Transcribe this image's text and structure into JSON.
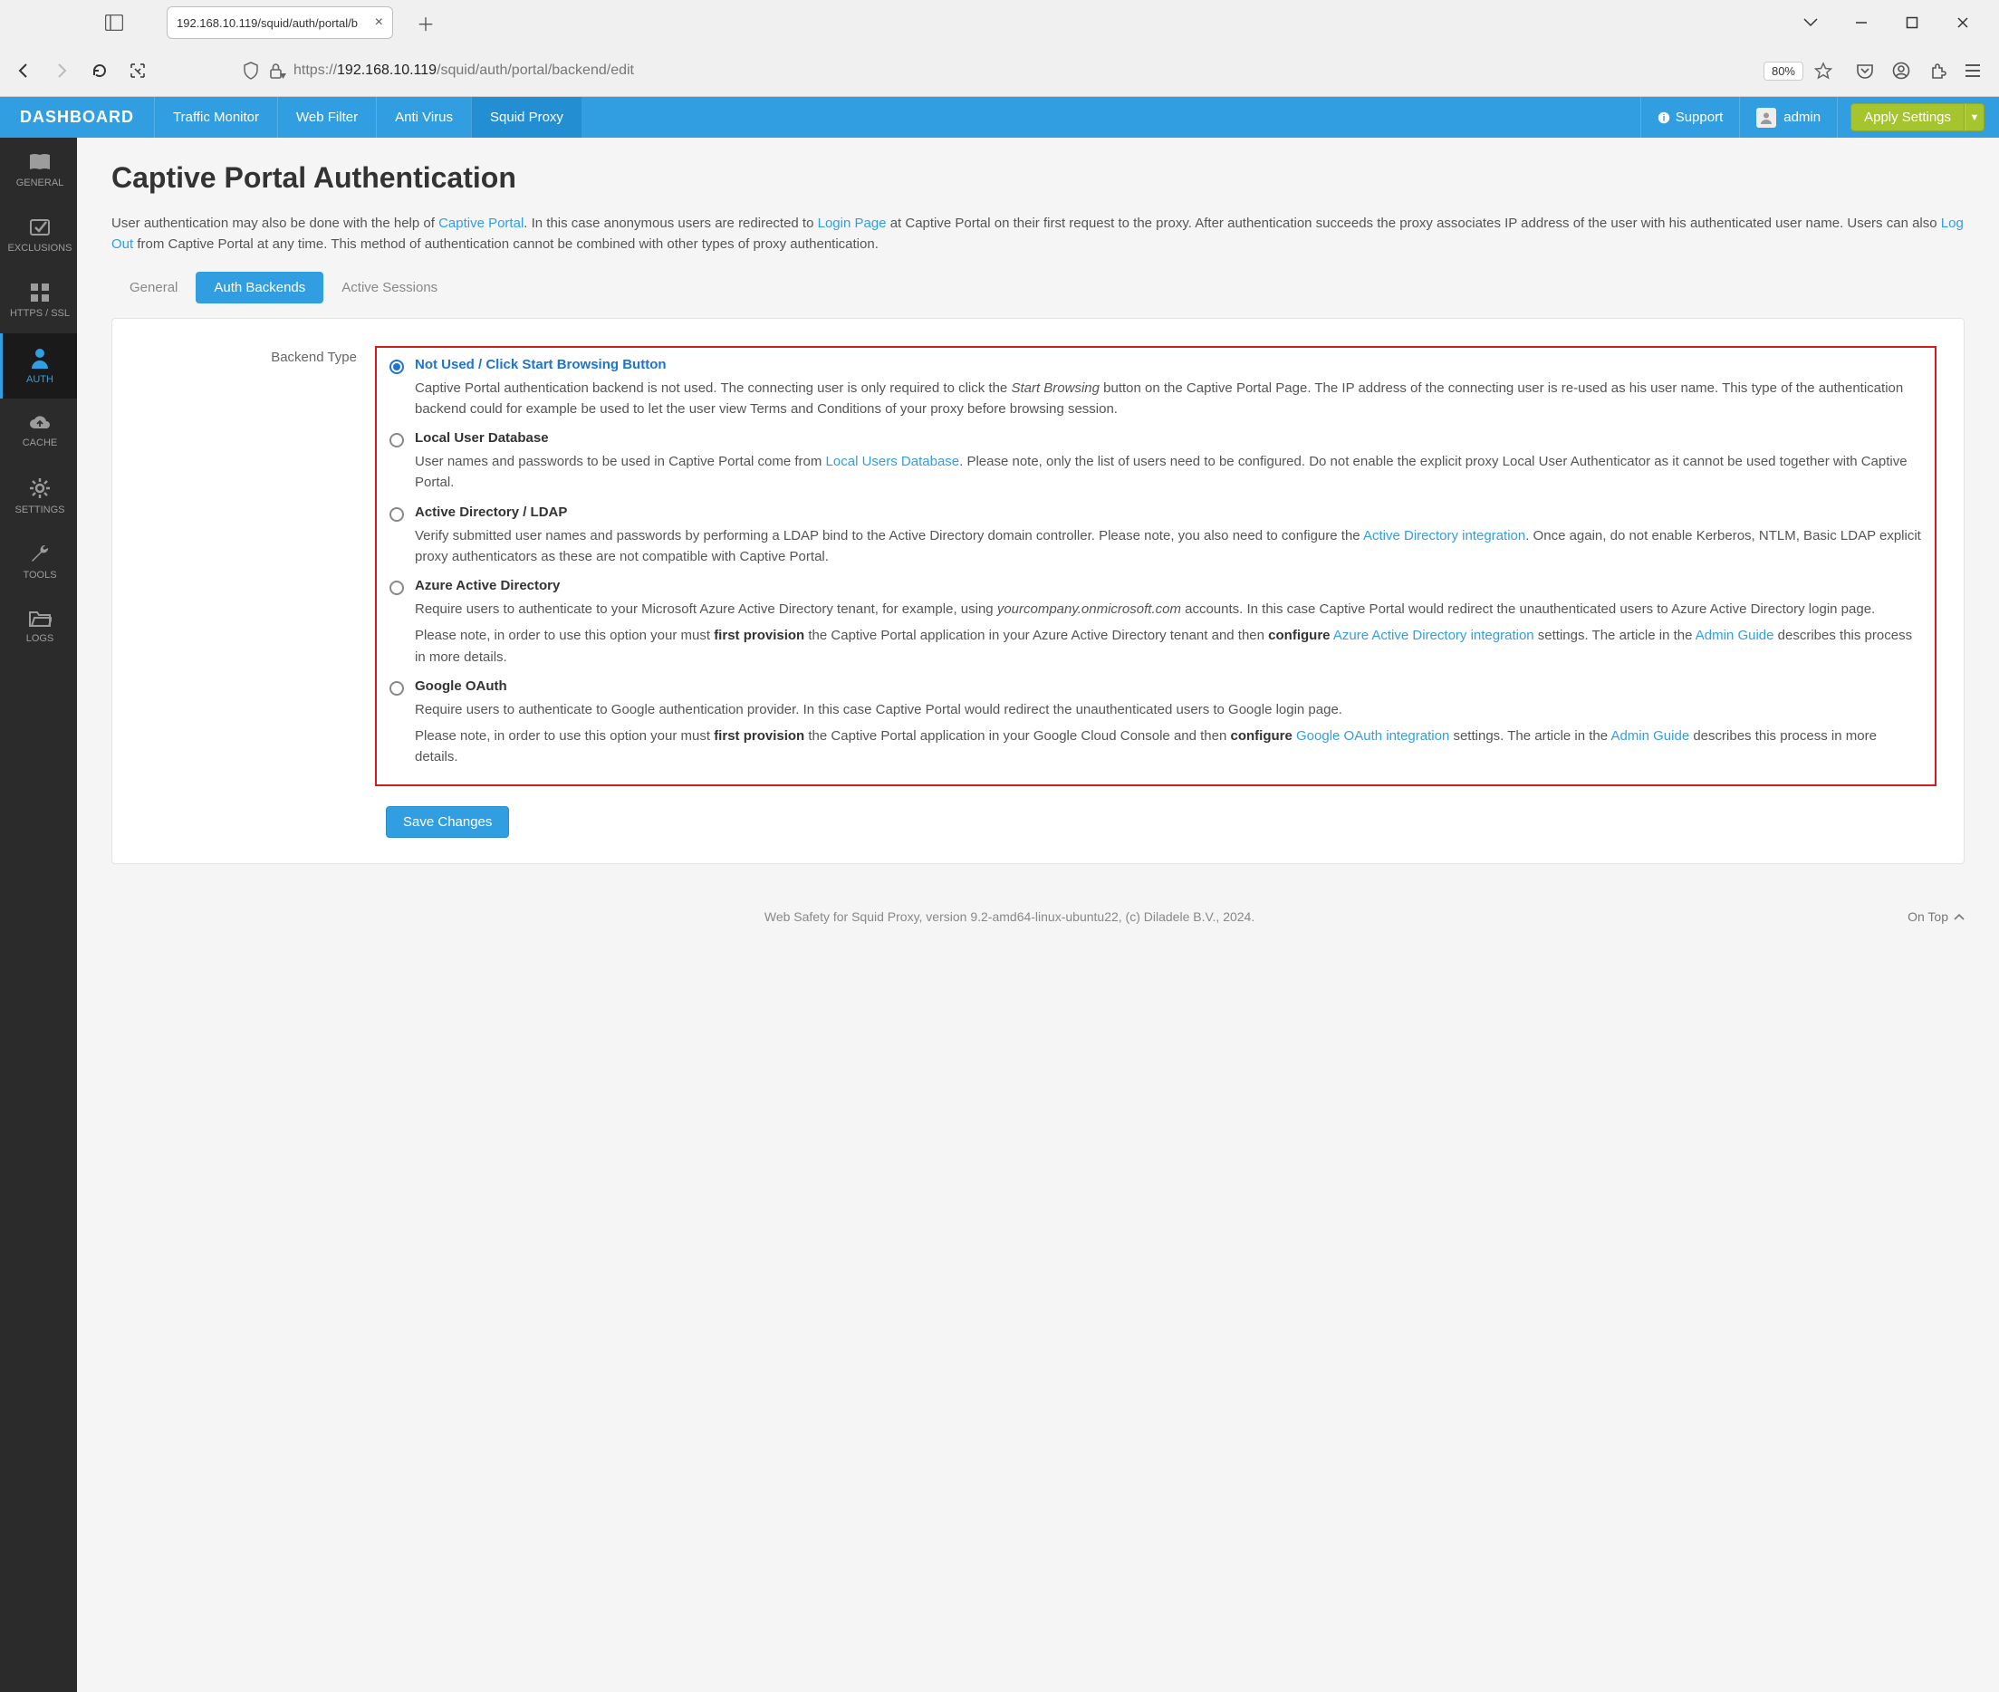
{
  "browser": {
    "tab_title": "192.168.10.119/squid/auth/portal/b",
    "url_prefix": "https://",
    "url_host": "192.168.10.119",
    "url_path": "/squid/auth/portal/backend/edit",
    "zoom": "80%"
  },
  "topbar": {
    "brand": "DASHBOARD",
    "nav": [
      "Traffic Monitor",
      "Web Filter",
      "Anti Virus",
      "Squid Proxy"
    ],
    "nav_active_index": 3,
    "support": "Support",
    "user": "admin",
    "apply": "Apply Settings"
  },
  "sidebar": {
    "items": [
      {
        "label": "GENERAL",
        "icon": "book"
      },
      {
        "label": "EXCLUSIONS",
        "icon": "check"
      },
      {
        "label": "HTTPS / SSL",
        "icon": "grid"
      },
      {
        "label": "AUTH",
        "icon": "user"
      },
      {
        "label": "CACHE",
        "icon": "cloud"
      },
      {
        "label": "SETTINGS",
        "icon": "gear"
      },
      {
        "label": "TOOLS",
        "icon": "wrench"
      },
      {
        "label": "LOGS",
        "icon": "folder"
      }
    ],
    "active_index": 3
  },
  "page": {
    "title": "Captive Portal Authentication",
    "intro_1": "User authentication may also be done with the help of ",
    "intro_link1": "Captive Portal",
    "intro_2": ". In this case anonymous users are redirected to ",
    "intro_link2": "Login Page",
    "intro_3": " at Captive Portal on their first request to the proxy. After authentication succeeds the proxy associates IP address of the user with his authenticated user name. Users can also ",
    "intro_link3": "Log Out",
    "intro_4": " from Captive Portal at any time. This method of authentication cannot be combined with other types of proxy authentication."
  },
  "tabs": {
    "items": [
      "General",
      "Auth Backends",
      "Active Sessions"
    ],
    "active_index": 1
  },
  "form": {
    "label": "Backend Type",
    "save_label": "Save Changes"
  },
  "options": {
    "selected_index": 0,
    "o0": {
      "title": "Not Used / Click Start Browsing Button"
    },
    "o0d": {
      "p1": "Captive Portal authentication backend is not used. The connecting user is only required to click the ",
      "em1": "Start Browsing",
      "p2": " button on the Captive Portal Page. The IP address of the connecting user is re-used as his user name. This type of the authentication backend could for example be used to let the user view Terms and Conditions of your proxy before browsing session."
    },
    "o1": {
      "title": "Local User Database"
    },
    "o1d": {
      "p1": "User names and passwords to be used in Captive Portal come from ",
      "a1": "Local Users Database",
      "p2": ". Please note, only the list of users need to be configured. Do not enable the explicit proxy Local User Authenticator as it cannot be used together with Captive Portal."
    },
    "o2": {
      "title": "Active Directory / LDAP"
    },
    "o2d": {
      "p1": "Verify submitted user names and passwords by performing a LDAP bind to the Active Directory domain controller. Please note, you also need to configure the ",
      "a1": "Active Directory integration",
      "p2": ". Once again, do not enable Kerberos, NTLM, Basic LDAP explicit proxy authenticators as these are not compatible with Captive Portal."
    },
    "o3": {
      "title": "Azure Active Directory"
    },
    "o3d": {
      "p1": "Require users to authenticate to your Microsoft Azure Active Directory tenant, for example, using ",
      "em1": "yourcompany.onmicrosoft.com",
      "p2": " accounts. In this case Captive Portal would redirect the unauthenticated users to Azure Active Directory login page.",
      "p3": "Please note, in order to use this option your must ",
      "b1": "first provision",
      "p4": " the Captive Portal application in your Azure Active Directory tenant and then ",
      "b2": "configure",
      "sp": " ",
      "a1": "Azure Active Directory integration",
      "p5": " settings. The article in the ",
      "a2": "Admin Guide",
      "p6": " describes this process in more details."
    },
    "o4": {
      "title": "Google OAuth"
    },
    "o4d": {
      "p1": "Require users to authenticate to Google authentication provider. In this case Captive Portal would redirect the unauthenticated users to Google login page.",
      "p2": "Please note, in order to use this option your must ",
      "b1": "first provision",
      "p3": " the Captive Portal application in your Google Cloud Console and then ",
      "b2": "configure",
      "sp": " ",
      "a1": "Google OAuth integration",
      "p4": " settings. The article in the ",
      "a2": "Admin Guide",
      "p5": " describes this process in more details."
    }
  },
  "footer": {
    "text": "Web Safety for Squid Proxy, version 9.2-amd64-linux-ubuntu22, (c) Diladele B.V., 2024.",
    "ontop": "On Top"
  }
}
